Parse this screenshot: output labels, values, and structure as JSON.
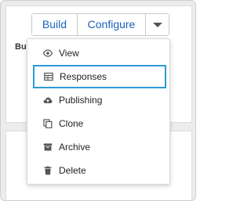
{
  "toolbar": {
    "build_label": "Build",
    "configure_label": "Configure",
    "dropdown_icon": "caret-down-icon",
    "accent_color": "#1c62b9"
  },
  "background": {
    "section_label": "Buil"
  },
  "menu": {
    "items": [
      {
        "label": "View",
        "icon": "eye-icon"
      },
      {
        "label": "Responses",
        "icon": "table-icon",
        "highlighted": true
      },
      {
        "label": "Publishing",
        "icon": "cloud-upload-icon"
      },
      {
        "label": "Clone",
        "icon": "copy-icon"
      },
      {
        "label": "Archive",
        "icon": "archive-icon"
      },
      {
        "label": "Delete",
        "icon": "trash-icon"
      }
    ],
    "highlight_color": "#2d9ad6"
  }
}
